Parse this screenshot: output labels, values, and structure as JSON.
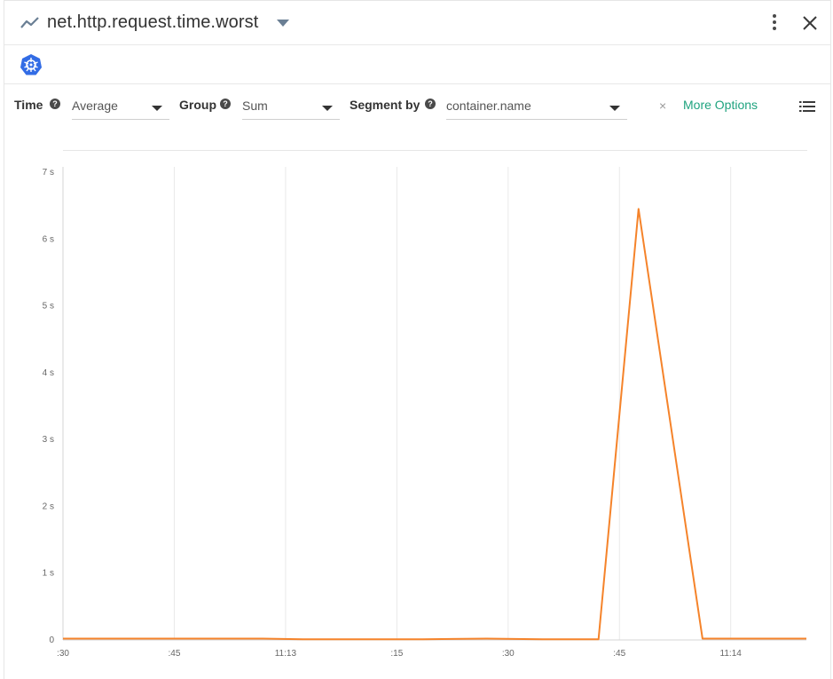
{
  "header": {
    "title": "net.http.request.time.worst",
    "metric_icon": "line-chart-icon",
    "menu_icon": "more-vertical-icon",
    "close_icon": "close-icon"
  },
  "scope": {
    "icon": "kubernetes-icon"
  },
  "controls": {
    "time_label": "Time",
    "time_value": "Average",
    "group_label": "Group",
    "group_value": "Sum",
    "segment_label": "Segment by",
    "segment_value": "container.name",
    "clear_icon": "×",
    "more_options": "More Options",
    "legend_icon": "list-icon",
    "help_glyph": "?"
  },
  "colors": {
    "series": "#f5832a",
    "accent": "#1fa37f",
    "kube": "#326ce5"
  },
  "chart_data": {
    "type": "line",
    "x_tick_labels": [
      ":30",
      ":45",
      "11:13",
      ":15",
      ":30",
      ":45",
      "11:14"
    ],
    "y_tick_labels": [
      "0",
      "1 s",
      "2 s",
      "3 s",
      "4 s",
      "5 s",
      "6 s",
      "7 s"
    ],
    "y_unit": "s",
    "ylim": [
      0,
      7
    ],
    "grid": "vertical",
    "series": [
      {
        "color": "#f5832a",
        "x": [
          0,
          2.5,
          3,
          4.5,
          5.3,
          6,
          6.7,
          7.2,
          8,
          8.4,
          9.3
        ],
        "y": [
          0.02,
          0.02,
          0.01,
          0.01,
          0.02,
          0.01,
          0.01,
          6.45,
          0.02,
          0.02,
          0.02
        ]
      }
    ]
  }
}
